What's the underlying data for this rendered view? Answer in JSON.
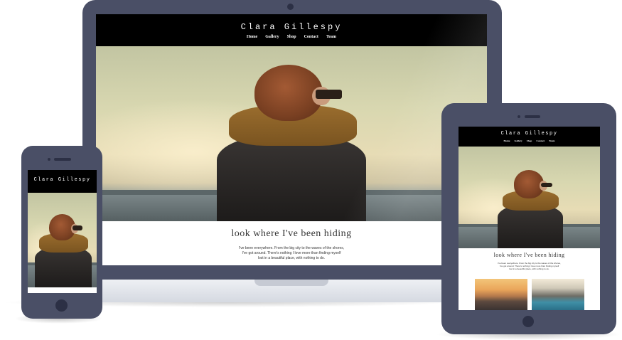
{
  "site": {
    "title": "Clara Gillespy",
    "nav": [
      "Home",
      "Gallery",
      "Shop",
      "Contact",
      "Team"
    ],
    "headline": "look where I've been hiding",
    "paragraph_lines": [
      "I've been everywhere. From the big city to the waves of the shores,",
      "I've got around. There's nothing I love more than finding myself",
      "lost in a beautiful place, with nothing to do."
    ]
  },
  "colors": {
    "device_frame": "#4a4f66",
    "header_bg": "#000000",
    "header_text": "#ffffff",
    "headline_text": "#333333"
  },
  "devices": [
    "laptop",
    "tablet",
    "phone"
  ]
}
